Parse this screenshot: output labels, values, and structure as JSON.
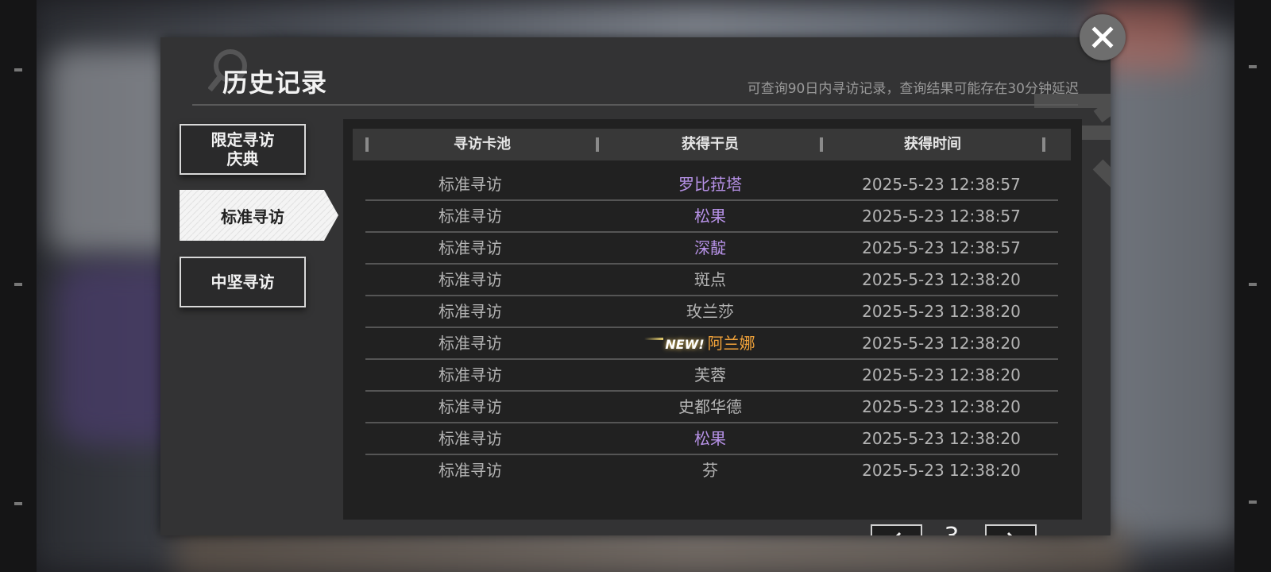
{
  "header": {
    "title": "历史记录",
    "hint": "可查询90日内寻访记录，查询结果可能存在30分钟延迟"
  },
  "tabs": [
    {
      "label": "限定寻访\n庆典",
      "active": false
    },
    {
      "label": "标准寻访",
      "active": true
    },
    {
      "label": "中坚寻访",
      "active": false
    }
  ],
  "table": {
    "columns": [
      "寻访卡池",
      "获得干员",
      "获得时间"
    ],
    "rows": [
      {
        "pool": "标准寻访",
        "operator": "罗比菈塔",
        "time": "2025-5-23 12:38:57",
        "rarity": "purple",
        "new": false
      },
      {
        "pool": "标准寻访",
        "operator": "松果",
        "time": "2025-5-23 12:38:57",
        "rarity": "purple",
        "new": false
      },
      {
        "pool": "标准寻访",
        "operator": "深靛",
        "time": "2025-5-23 12:38:57",
        "rarity": "purple",
        "new": false
      },
      {
        "pool": "标准寻访",
        "operator": "斑点",
        "time": "2025-5-23 12:38:20",
        "rarity": "gray",
        "new": false
      },
      {
        "pool": "标准寻访",
        "operator": "玫兰莎",
        "time": "2025-5-23 12:38:20",
        "rarity": "gray",
        "new": false
      },
      {
        "pool": "标准寻访",
        "operator": "阿兰娜",
        "time": "2025-5-23 12:38:20",
        "rarity": "orange",
        "new": true
      },
      {
        "pool": "标准寻访",
        "operator": "芙蓉",
        "time": "2025-5-23 12:38:20",
        "rarity": "gray",
        "new": false
      },
      {
        "pool": "标准寻访",
        "operator": "史都华德",
        "time": "2025-5-23 12:38:20",
        "rarity": "gray",
        "new": false
      },
      {
        "pool": "标准寻访",
        "operator": "松果",
        "time": "2025-5-23 12:38:20",
        "rarity": "purple",
        "new": false
      },
      {
        "pool": "标准寻访",
        "operator": "芬",
        "time": "2025-5-23 12:38:20",
        "rarity": "gray",
        "new": false
      }
    ],
    "new_label": "NEW!"
  },
  "pager": {
    "page": "3",
    "prev_icon": "chevron-left-icon",
    "next_icon": "chevron-right-icon"
  },
  "close_icon": "close-icon",
  "colors": {
    "purple": "#b691e6",
    "orange": "#f2a33a",
    "gray": "#b4b4b4",
    "panel": "#333334"
  }
}
